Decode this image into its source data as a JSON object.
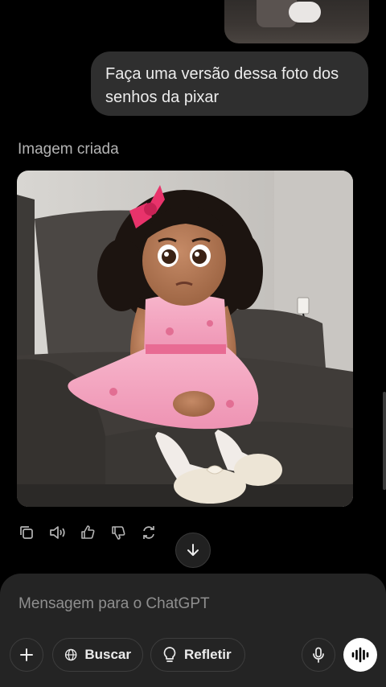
{
  "conversation": {
    "user_message": "Faça uma versão dessa foto dos senhos da pixar",
    "assistant_label": "Imagem criada"
  },
  "actions": [
    {
      "icon": "copy-icon"
    },
    {
      "icon": "read-aloud-icon"
    },
    {
      "icon": "thumbs-up-icon"
    },
    {
      "icon": "thumbs-down-icon"
    },
    {
      "icon": "regenerate-icon"
    }
  ],
  "composer": {
    "placeholder": "Mensagem para o ChatGPT",
    "search_label": "Buscar",
    "reason_label": "Refletir"
  },
  "colors": {
    "background": "#000000",
    "bubble": "#2f2f2f",
    "composer": "#242424",
    "dress_pink": "#f4a6c0",
    "bow_pink": "#e8336b"
  }
}
